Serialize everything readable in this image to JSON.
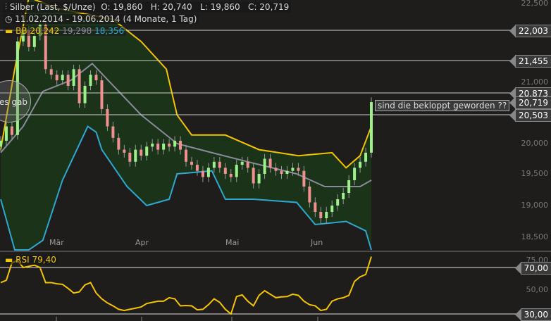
{
  "header": {
    "icon": "candlestick-icon",
    "instrument": "Silber (Last, $/Unze)",
    "ohlc": "O: 19,860   H: 20,740   L: 19,860   C: 20,719",
    "date_icon": "clock-icon",
    "range": "11.02.2014 - 19.06.2014 (4 Monate, 1 Tag)"
  },
  "bb_legend": {
    "label": "BB",
    "upper": "20,242",
    "middle": "19,298",
    "lower": "18,356"
  },
  "rsi_legend": {
    "label": "RSI",
    "value": "79,40"
  },
  "annotation": "sind die bekloppt geworden ??",
  "bubble_text": "tes gab",
  "colors": {
    "bg": "#1e1d1c",
    "upper": "#f5c400",
    "middle": "#8a8a9a",
    "lower": "#2fa8d0",
    "fill": "#1a3319",
    "up": "#9ef08a",
    "down": "#f09090",
    "rsi": "#f5c400"
  },
  "chart_data": [
    {
      "type": "candlestick",
      "title": "Silber (Last, $/Unze)",
      "yticks": [
        "22,500",
        "21,000",
        "20,000",
        "19,500",
        "19,000",
        "18,500"
      ],
      "price_tags": [
        "22,003",
        "21,455",
        "20,873",
        "20,719",
        "20,503"
      ],
      "xticks": [
        "Mär",
        "Apr",
        "Mai",
        "Jun"
      ],
      "closes": [
        20.05,
        20.3,
        20.15,
        21.8,
        22.0,
        21.7,
        21.9,
        22.1,
        21.3,
        21.2,
        21.1,
        21.2,
        21.0,
        21.3,
        20.7,
        21.0,
        21.2,
        21.1,
        20.6,
        20.3,
        20.1,
        19.9,
        19.85,
        19.7,
        19.9,
        19.8,
        19.95,
        20.0,
        19.9,
        20.0,
        19.95,
        20.05,
        19.9,
        19.7,
        19.65,
        19.55,
        19.45,
        19.6,
        19.7,
        19.6,
        19.5,
        19.45,
        19.65,
        19.7,
        19.6,
        19.35,
        19.5,
        19.75,
        19.6,
        19.55,
        19.5,
        19.55,
        19.6,
        19.55,
        19.3,
        19.05,
        18.9,
        18.8,
        18.9,
        19.0,
        19.1,
        19.2,
        19.4,
        19.6,
        19.7,
        19.85,
        20.719
      ],
      "bb_upper": [
        [
          0,
          19.9
        ],
        [
          2.5,
          21.3
        ],
        [
          5,
          22.6
        ],
        [
          10,
          22.4
        ],
        [
          15,
          22.3
        ],
        [
          20,
          22.2
        ],
        [
          25,
          21.8
        ],
        [
          29.5,
          21.3
        ],
        [
          31.4,
          20.5
        ],
        [
          34,
          20.15
        ],
        [
          40,
          20.15
        ],
        [
          46,
          19.9
        ],
        [
          53,
          19.8
        ],
        [
          59,
          19.85
        ],
        [
          61.5,
          19.6
        ],
        [
          64,
          19.8
        ],
        [
          66,
          20.3
        ]
      ],
      "bb_middle": [
        [
          0,
          19.85
        ],
        [
          4,
          20.3
        ],
        [
          7.5,
          20.9
        ],
        [
          12.5,
          21.1
        ],
        [
          16.3,
          21.4
        ],
        [
          25,
          20.5
        ],
        [
          31.4,
          20.0
        ],
        [
          37.6,
          19.85
        ],
        [
          44,
          19.7
        ],
        [
          52.7,
          19.5
        ],
        [
          57.7,
          19.3
        ],
        [
          64,
          19.3
        ],
        [
          66,
          19.4
        ]
      ],
      "bb_lower": [
        [
          0,
          19.1
        ],
        [
          2.5,
          18.3
        ],
        [
          5,
          18.3
        ],
        [
          7.5,
          18.45
        ],
        [
          11,
          19.4
        ],
        [
          15.5,
          20.3
        ],
        [
          17,
          20.2
        ],
        [
          18,
          19.9
        ],
        [
          22.5,
          19.3
        ],
        [
          26,
          19.0
        ],
        [
          30,
          19.1
        ],
        [
          31.4,
          19.5
        ],
        [
          37.6,
          19.55
        ],
        [
          40,
          19.1
        ],
        [
          45,
          19.1
        ],
        [
          52.7,
          19.05
        ],
        [
          56,
          18.7
        ],
        [
          61.5,
          18.75
        ],
        [
          65,
          18.6
        ],
        [
          66,
          18.3
        ]
      ]
    },
    {
      "type": "line",
      "title": "RSI",
      "yticks": [
        "75,00",
        "70,00",
        "50,00",
        "30,00"
      ],
      "levels": [
        70,
        30
      ],
      "values": [
        57,
        59,
        74,
        76,
        70,
        71,
        72,
        70,
        57,
        57,
        56,
        55.5,
        52,
        48,
        49,
        55,
        57,
        48,
        43,
        39.5,
        37,
        34,
        33,
        34,
        35,
        36,
        39,
        40,
        41,
        41,
        44,
        43,
        37,
        37.3,
        37,
        33.6,
        34,
        38,
        43,
        40,
        34,
        30,
        45,
        46.4,
        41,
        37,
        46,
        50,
        47,
        44,
        44.7,
        45,
        47,
        46,
        41,
        38,
        37,
        33,
        34,
        41,
        43,
        44,
        46,
        58,
        62,
        64,
        79.4
      ]
    }
  ]
}
